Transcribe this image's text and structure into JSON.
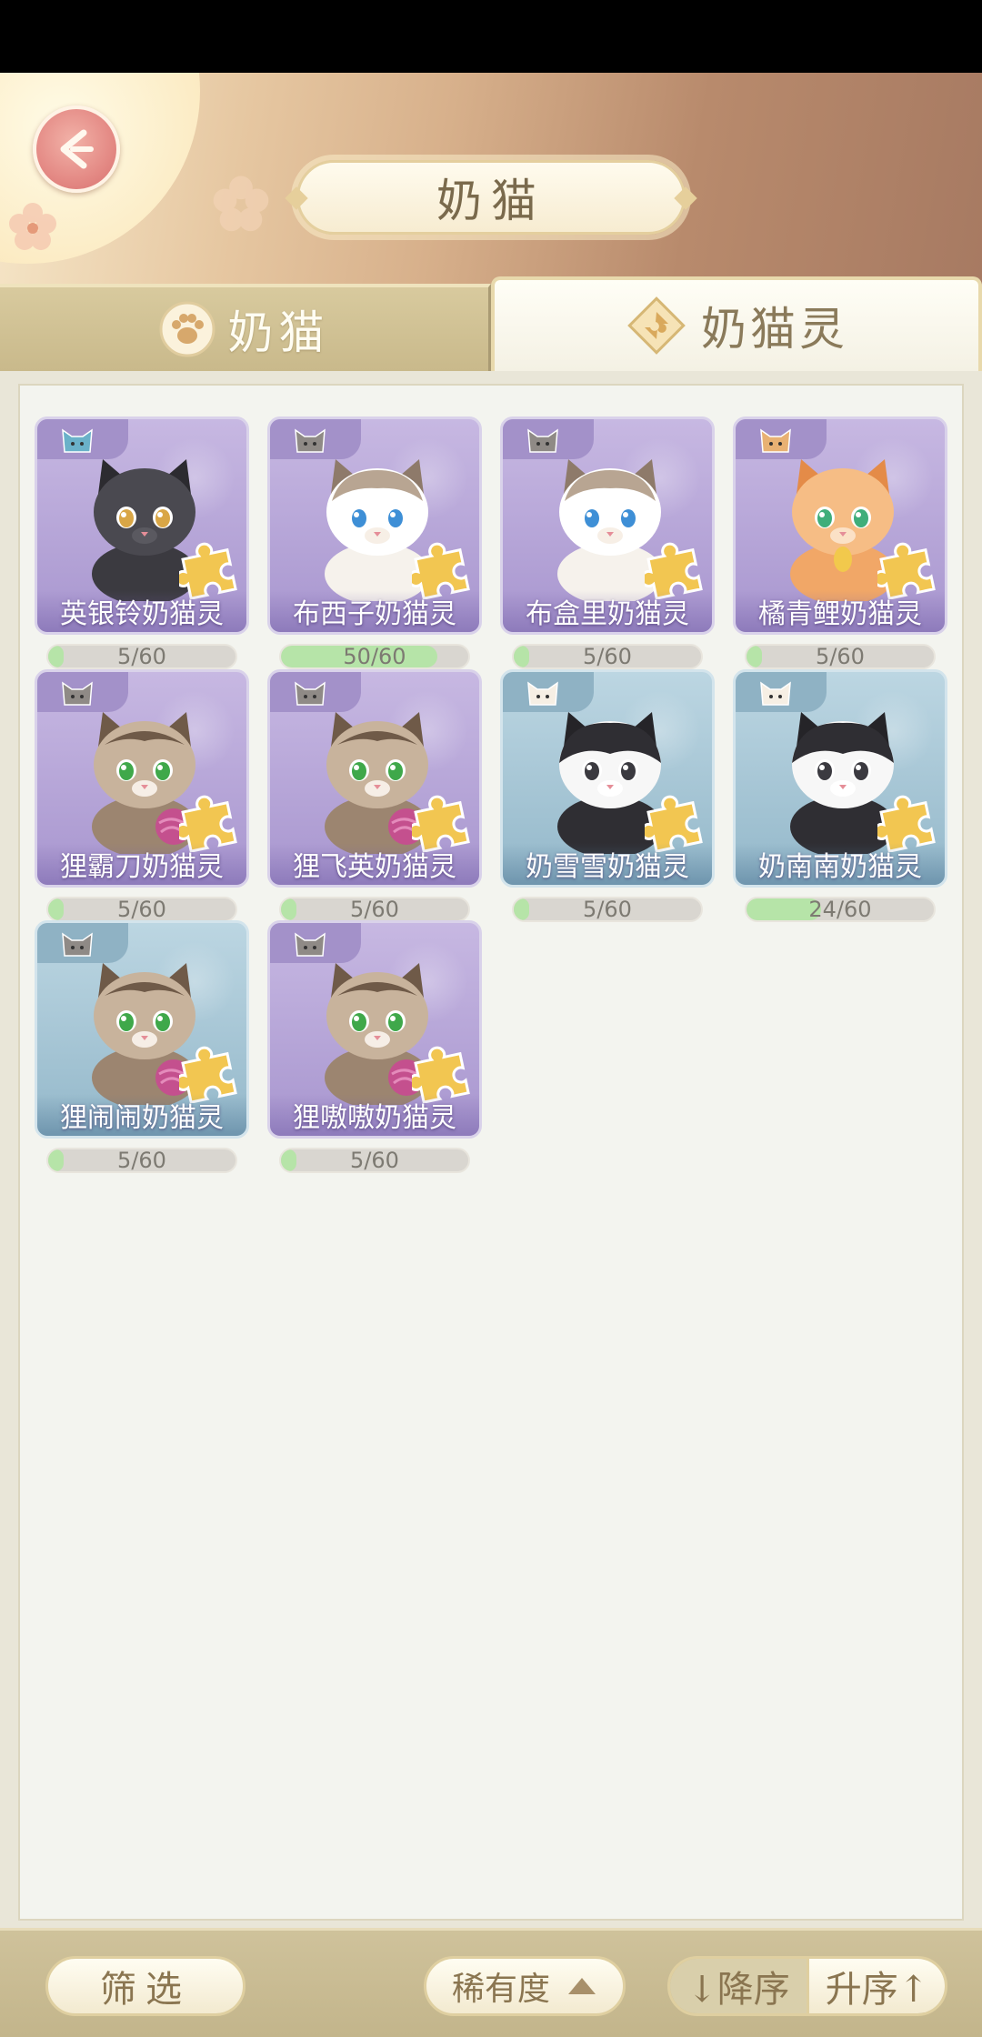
{
  "header": {
    "title": "奶猫",
    "back_icon": "back-arrow-icon"
  },
  "tabs": [
    {
      "label": "奶猫",
      "icon": "paw-icon",
      "active": false
    },
    {
      "label": "奶猫灵",
      "icon": "puzzle-diamond-icon",
      "active": true
    }
  ],
  "cards": [
    {
      "name": "英银铃奶猫灵",
      "progress_text": "5/60",
      "progress": 0.0833,
      "theme": "purple",
      "cat_color": "black"
    },
    {
      "name": "布西子奶猫灵",
      "progress_text": "50/60",
      "progress": 0.8333,
      "theme": "purple",
      "cat_color": "ragdoll"
    },
    {
      "name": "布盒里奶猫灵",
      "progress_text": "5/60",
      "progress": 0.0833,
      "theme": "purple",
      "cat_color": "ragdoll"
    },
    {
      "name": "橘青鲤奶猫灵",
      "progress_text": "5/60",
      "progress": 0.0833,
      "theme": "purple",
      "cat_color": "orange"
    },
    {
      "name": "狸霸刀奶猫灵",
      "progress_text": "5/60",
      "progress": 0.0833,
      "theme": "purple",
      "cat_color": "tabby"
    },
    {
      "name": "狸飞英奶猫灵",
      "progress_text": "5/60",
      "progress": 0.0833,
      "theme": "purple",
      "cat_color": "tabby"
    },
    {
      "name": "奶雪雪奶猫灵",
      "progress_text": "5/60",
      "progress": 0.0833,
      "theme": "blue",
      "cat_color": "tuxedo"
    },
    {
      "name": "奶南南奶猫灵",
      "progress_text": "24/60",
      "progress": 0.4,
      "theme": "blue",
      "cat_color": "tuxedo"
    },
    {
      "name": "狸闹闹奶猫灵",
      "progress_text": "5/60",
      "progress": 0.0833,
      "theme": "blue",
      "cat_color": "tabby"
    },
    {
      "name": "狸嗷嗷奶猫灵",
      "progress_text": "5/60",
      "progress": 0.0833,
      "theme": "purple",
      "cat_color": "tabby"
    }
  ],
  "bottom": {
    "filter_label": "筛选",
    "rarity_label": "稀有度",
    "rarity_icon": "triangle-up-icon",
    "sort_desc_label": "↓降序",
    "sort_asc_label": "升序↑"
  },
  "colors": {
    "progress_fill": "#b6e4a8",
    "purple_card": "#a896cf",
    "blue_card": "#94b8ca",
    "accent_text": "#8a7550"
  }
}
